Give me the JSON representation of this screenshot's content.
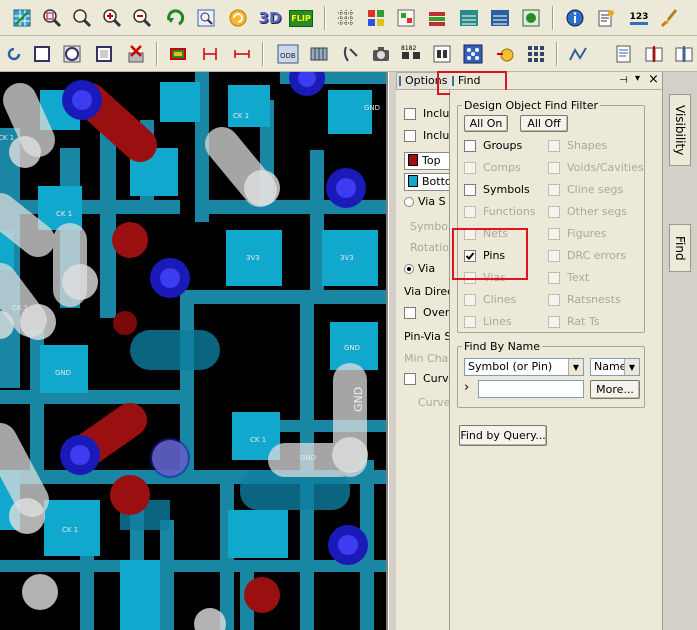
{
  "options_tab": {
    "label": "Options"
  },
  "find_tab": {
    "label": "Find"
  },
  "pin_icon": "pin-icon",
  "dropdown_glyph": "▾",
  "close_glyph": "×",
  "filter": {
    "legend": "Design Object Find Filter",
    "all_on": "All On",
    "all_off": "All Off",
    "left": [
      {
        "label": "Groups",
        "checked": false,
        "enabled": true
      },
      {
        "label": "Comps",
        "checked": false,
        "enabled": false
      },
      {
        "label": "Symbols",
        "checked": false,
        "enabled": true
      },
      {
        "label": "Functions",
        "checked": false,
        "enabled": false
      },
      {
        "label": "Nets",
        "checked": false,
        "enabled": false
      },
      {
        "label": "Pins",
        "checked": true,
        "enabled": true
      },
      {
        "label": "Vias",
        "checked": false,
        "enabled": false
      },
      {
        "label": "Clines",
        "checked": false,
        "enabled": false
      },
      {
        "label": "Lines",
        "checked": false,
        "enabled": false
      }
    ],
    "right": [
      {
        "label": "Shapes",
        "checked": false,
        "enabled": false
      },
      {
        "label": "Voids/Cavities",
        "checked": false,
        "enabled": false
      },
      {
        "label": "Cline segs",
        "checked": false,
        "enabled": false
      },
      {
        "label": "Other segs",
        "checked": false,
        "enabled": false
      },
      {
        "label": "Figures",
        "checked": false,
        "enabled": false
      },
      {
        "label": "DRC errors",
        "checked": false,
        "enabled": false
      },
      {
        "label": "Text",
        "checked": false,
        "enabled": false
      },
      {
        "label": "Ratsnests",
        "checked": false,
        "enabled": false
      },
      {
        "label": "Rat Ts",
        "checked": false,
        "enabled": false
      }
    ]
  },
  "find_by_name": {
    "legend": "Find By Name",
    "type_value": "Symbol (or Pin)",
    "mode_value": "Name",
    "arrow_glyph": "›",
    "input_value": "",
    "more_label": "More..."
  },
  "find_by_query_label": "Find by Query...",
  "options": {
    "include1": "Include",
    "include2": "Include",
    "top": "Top",
    "bottom": "Bottom",
    "via_s": "Via S",
    "symbol": "Symbol",
    "rotation": "Rotation",
    "via": "Via",
    "via_direction": "Via Direc",
    "override": "Overr",
    "pin_via": "Pin-Via S",
    "min_channel": "Min Chan",
    "curve1": "Curve",
    "curve2": "Curve"
  },
  "side_tabs": [
    "Visibility",
    "Find"
  ],
  "toolbar_text": {
    "flip": "FLIP",
    "tri_d": "3D",
    "num": "123",
    "odb": "ODB",
    "ids": "8182\nd1\nd2"
  },
  "canvas_labels": {
    "gnd": "GND",
    "v33": "3V3",
    "ck1": "CK 1",
    "gnd_vertical": "GND"
  },
  "colors": {
    "pcb_trace": "#1e9fc0",
    "pcb_pad": "#10a8cc",
    "pcb_via_blue": "#1a1ab8",
    "pcb_via_red": "#9a1010",
    "pcb_white": "#dcdcdc",
    "highlight_red": "#e0141e",
    "top_swatch": "#9a1010",
    "bottom_swatch": "#10a8cc"
  }
}
